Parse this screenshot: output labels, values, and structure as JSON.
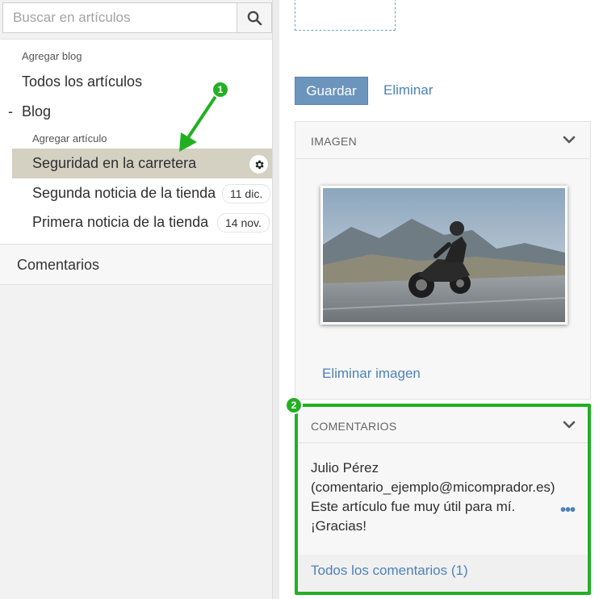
{
  "search": {
    "placeholder": "Buscar en artículos",
    "value": ""
  },
  "tree": {
    "add_blog": "Agregar blog",
    "all_articles": "Todos los artículos",
    "blog_toggle": "-",
    "blog": "Blog",
    "add_article": "Agregar artículo",
    "articles": [
      {
        "title": "Seguridad en la carretera",
        "date": ""
      },
      {
        "title": "Segunda noticia de la tienda",
        "date": "11 dic."
      },
      {
        "title": "Primera noticia de la tienda",
        "date": "14 nov."
      }
    ],
    "comments": "Comentarios"
  },
  "toolbar": {
    "save_label": "Guardar",
    "delete_label": "Eliminar"
  },
  "image_panel": {
    "title": "IMAGEN",
    "remove_label": "Eliminar imagen"
  },
  "comments_panel": {
    "title": "COMENTARIOS",
    "author": "Julio Pérez",
    "email": "(comentario_ejemplo@micomprador.es)",
    "line1": "Este artículo fue muy útil para mí.",
    "line2": "¡Gracias!",
    "more": "•••",
    "all_link": "Todos los comentarios (1)"
  },
  "annotations": {
    "step1": "1",
    "step2": "2"
  },
  "colors": {
    "accent_green": "#22b022",
    "link_blue": "#4d82b8",
    "button_blue": "#6b95bd",
    "selected_row": "#d4d0c2"
  },
  "icons": {
    "search": "search-icon",
    "gear": "gear-icon",
    "chevron": "chevron-down-icon"
  }
}
